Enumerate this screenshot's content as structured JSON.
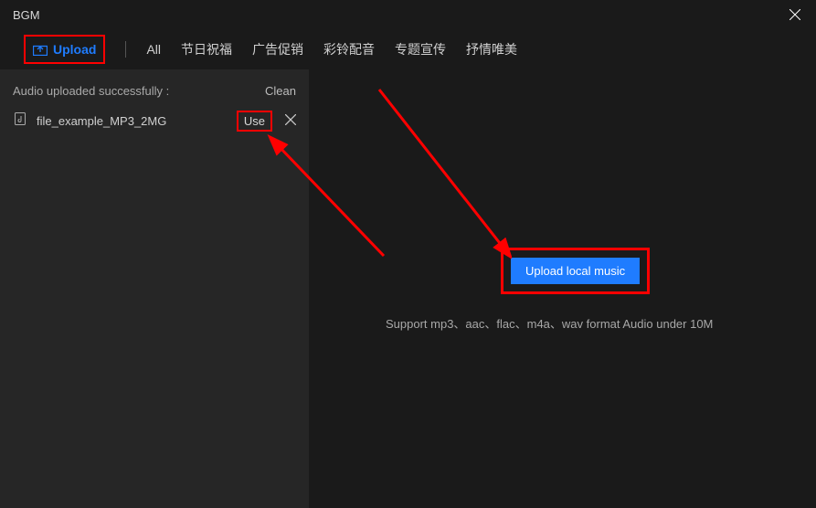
{
  "window": {
    "title": "BGM"
  },
  "tabs": {
    "upload_label": "Upload",
    "items": [
      "All",
      "节日祝福",
      "广告促销",
      "彩铃配音",
      "专题宣传",
      "抒情唯美"
    ]
  },
  "sidebar": {
    "status_label": "Audio uploaded successfully :",
    "clean_label": "Clean",
    "file": {
      "name": "file_example_MP3_2MG",
      "use_label": "Use"
    }
  },
  "main": {
    "upload_button_label": "Upload local music",
    "support_text": "Support mp3、aac、flac、m4a、wav format Audio under 10M"
  }
}
